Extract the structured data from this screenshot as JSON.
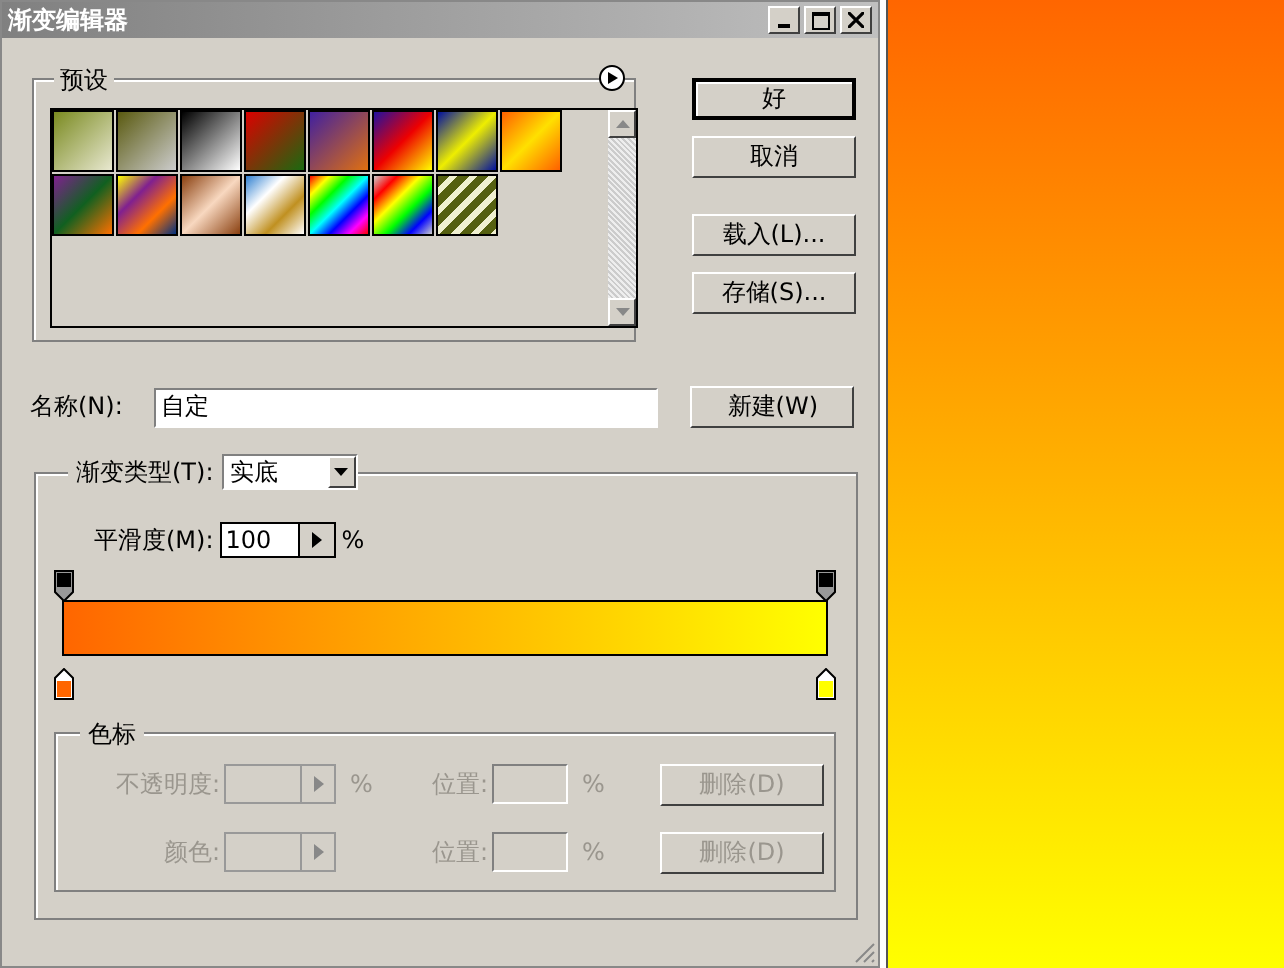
{
  "window": {
    "title": "渐变编辑器"
  },
  "presets": {
    "title": "预设"
  },
  "buttons": {
    "ok": "好",
    "cancel": "取消",
    "load": "载入(L)...",
    "save": "存储(S)..."
  },
  "name": {
    "label": "名称(N):",
    "value": "自定",
    "new_button": "新建(W)"
  },
  "gradient": {
    "type_label": "渐变类型(T):",
    "type_value": "实底",
    "smoothness_label": "平滑度(M):",
    "smoothness_value": "100",
    "smoothness_unit": "%",
    "opacity_stops": [
      {
        "color": "#000000"
      },
      {
        "color": "#000000"
      }
    ],
    "color_stops": [
      {
        "color": "#ff6600"
      },
      {
        "color": "#ffff00"
      }
    ]
  },
  "stop_panel": {
    "title": "色标",
    "rows": [
      {
        "label": "不透明度:",
        "unit": "%",
        "position_label": "位置:",
        "position_unit": "%",
        "delete": "删除(D)",
        "disabled": true
      },
      {
        "label": "颜色:",
        "unit": "",
        "position_label": "位置:",
        "position_unit": "%",
        "delete": "删除(D)",
        "disabled": true
      }
    ]
  }
}
